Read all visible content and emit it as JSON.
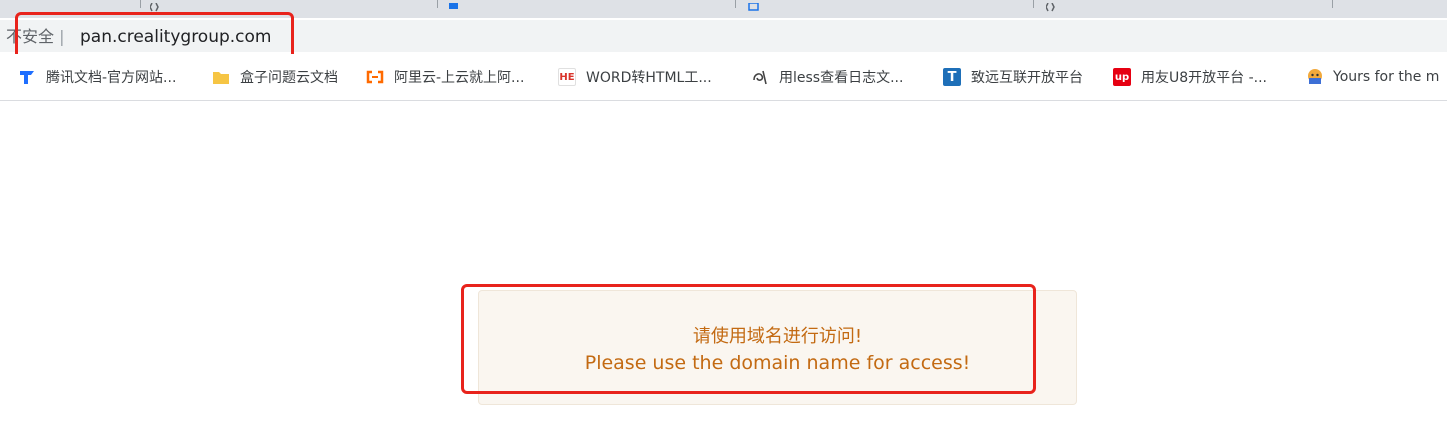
{
  "browser": {
    "address_bar": {
      "security_label": "不安全",
      "url": "pan.crealitygroup.com"
    },
    "bookmarks": [
      {
        "label": "腾讯文档-官方网站...",
        "icon": "tencent-docs-icon",
        "color": "#1f6fff"
      },
      {
        "label": "盒子问题云文档",
        "icon": "folder-icon",
        "color": "#f6c544"
      },
      {
        "label": "阿里云-上云就上阿...",
        "icon": "aliyun-icon",
        "color": "#ff6a00"
      },
      {
        "label": "WORD转HTML工...",
        "icon": "he-icon",
        "color": "#d9342b"
      },
      {
        "label": "用less查看日志文...",
        "icon": "swirl-icon",
        "color": "#444444"
      },
      {
        "label": "致远互联开放平台",
        "icon": "t-logo-icon",
        "color": "#1e6fb8"
      },
      {
        "label": "用友U8开放平台 -...",
        "icon": "up-logo-icon",
        "color": "#e60012"
      },
      {
        "label": "Yours for the m",
        "icon": "avatar-icon",
        "color": "#f2a93b"
      }
    ]
  },
  "notice": {
    "message_zh": "请使用域名进行访问!",
    "message_en": "Please use the domain name for access!"
  },
  "colors": {
    "annotation": "#e8231c",
    "notice_text": "#c36a12",
    "notice_bg": "#faf6f0"
  }
}
